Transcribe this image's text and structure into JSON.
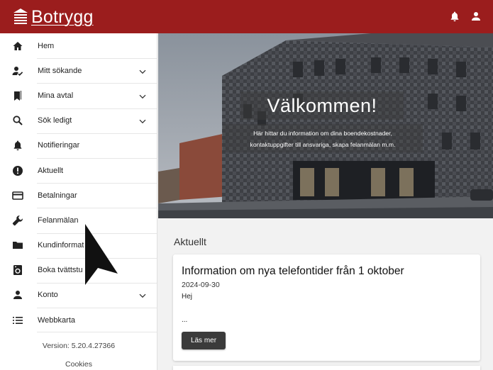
{
  "header": {
    "brand_name": "Botrygg",
    "brand_icon": "building-stack-icon",
    "actions": [
      {
        "name": "notifications",
        "icon": "bell-icon"
      },
      {
        "name": "account",
        "icon": "person-icon"
      }
    ]
  },
  "sidebar": {
    "items": [
      {
        "label": "Hem",
        "icon": "home-icon",
        "has_chevron": false
      },
      {
        "label": "Mitt sökande",
        "icon": "person-search-icon",
        "has_chevron": true
      },
      {
        "label": "Mina avtal",
        "icon": "bookmarks-icon",
        "has_chevron": true
      },
      {
        "label": "Sök ledigt",
        "icon": "search-icon",
        "has_chevron": true
      },
      {
        "label": "Notifieringar",
        "icon": "bell-icon",
        "has_chevron": false
      },
      {
        "label": "Aktuellt",
        "icon": "alert-circle-icon",
        "has_chevron": false
      },
      {
        "label": "Betalningar",
        "icon": "credit-card-icon",
        "has_chevron": false
      },
      {
        "label": "Felanmälan",
        "icon": "wrench-icon",
        "has_chevron": false
      },
      {
        "label": "Kundinformat",
        "icon": "folder-icon",
        "has_chevron": false
      },
      {
        "label": "Boka tvättstu",
        "icon": "washing-machine-icon",
        "has_chevron": false
      },
      {
        "label": "Konto",
        "icon": "person-icon",
        "has_chevron": true
      },
      {
        "label": "Webbkarta",
        "icon": "list-icon",
        "has_chevron": false
      }
    ],
    "version": "Version: 5.20.4.27366",
    "cookies": "Cookies"
  },
  "hero": {
    "title": "Välkommen!",
    "subtitle_line1": "Här hittar du information om dina boendekostnader,",
    "subtitle_line2": "kontaktuppgifter till ansvariga, skapa felanmälan m.m."
  },
  "news": {
    "section_title": "Aktuellt",
    "cards": [
      {
        "title": "Information om nya telefontider från 1 oktober",
        "date": "2024-09-30",
        "body": "Hej",
        "ellipsis": "...",
        "button_label": "Läs mer"
      }
    ]
  },
  "colors": {
    "brand": "#9b1d1d",
    "button": "#3b3b3b"
  }
}
